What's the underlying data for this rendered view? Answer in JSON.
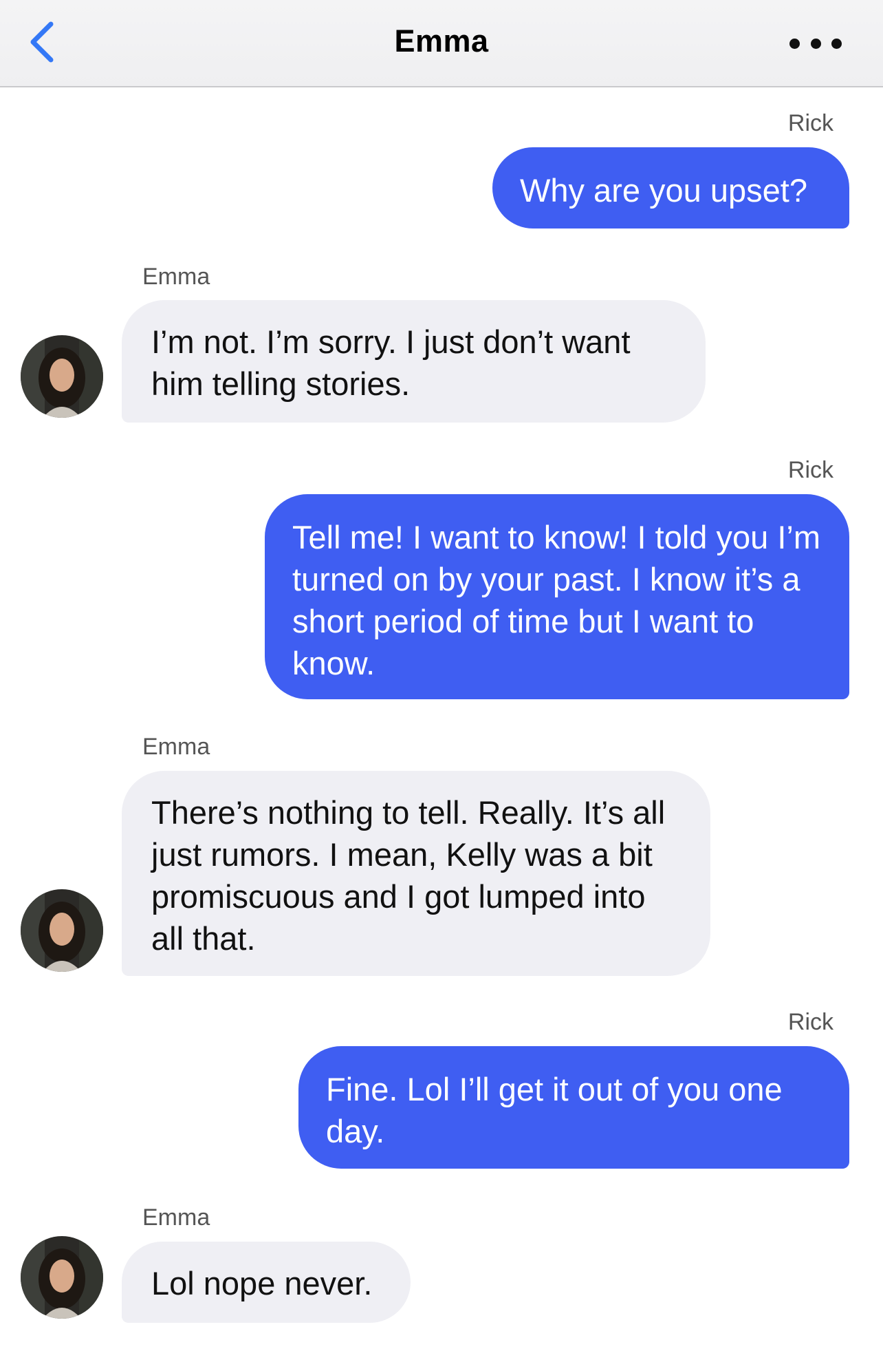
{
  "header": {
    "title": "Emma",
    "back_icon": "chevron-left-icon",
    "more_icon": "ellipsis-icon",
    "accent": "#3478f6"
  },
  "colors": {
    "outgoing_bubble": "#3f5ef2",
    "incoming_bubble": "#efeff4"
  },
  "messages": [
    {
      "sender": "Rick",
      "text": "Why are you upset?",
      "direction": "outgoing"
    },
    {
      "sender": "Emma",
      "text": "I’m not. I’m sorry. I just don’t want him telling stories.",
      "direction": "incoming"
    },
    {
      "sender": "Rick",
      "text": "Tell me! I want to know! I told you I’m turned on by your past. I know it’s a short period of time but I want to know.",
      "direction": "outgoing"
    },
    {
      "sender": "Emma",
      "text": "There’s nothing to tell. Really. It’s all just rumors. I mean, Kelly was a bit promiscuous and I got lumped into all that.",
      "direction": "incoming"
    },
    {
      "sender": "Rick",
      "text": "Fine. Lol I’ll get it out of you one day.",
      "direction": "outgoing"
    },
    {
      "sender": "Emma",
      "text": "Lol nope never.",
      "direction": "incoming"
    }
  ]
}
